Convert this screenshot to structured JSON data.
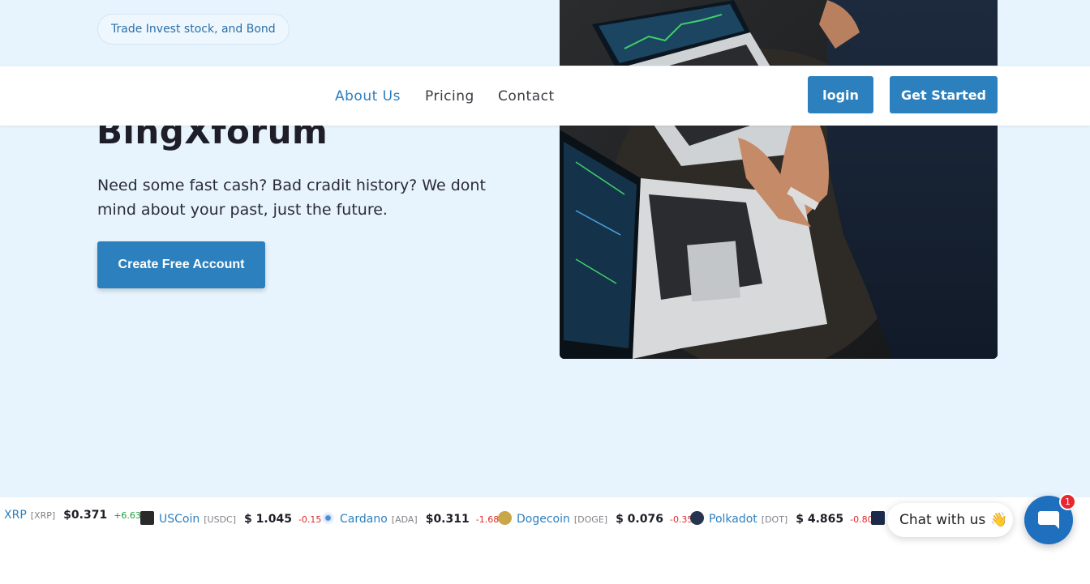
{
  "hero": {
    "pill_text": "Trade Invest stock, and Bond",
    "headline": "BingXforum",
    "lead": "Need some fast cash? Bad cradit history? We dont mind about your past, just the future.",
    "cta_label": "Create Free Account"
  },
  "nav": {
    "links": [
      {
        "label": "About Us",
        "active": true
      },
      {
        "label": "Pricing",
        "active": false
      },
      {
        "label": "Contact",
        "active": false
      }
    ],
    "login_label": "login",
    "start_label": "Get Started"
  },
  "ticker": [
    {
      "name": "XRP",
      "symbol": "[XRP]",
      "price": "$0.371",
      "change": "+6.63%",
      "direction": "up",
      "icon": "xrp-icon"
    },
    {
      "name": "USCoin",
      "symbol": "[USDC]",
      "price": "$ 1.045",
      "change": "-0.15%",
      "direction": "down",
      "icon": "usdc-icon"
    },
    {
      "name": "Cardano",
      "symbol": "[ADA]",
      "price": "$0.311",
      "change": "-1.68%",
      "direction": "down",
      "icon": "cardano-icon"
    },
    {
      "name": "Dogecoin",
      "symbol": "[DOGE]",
      "price": "$ 0.076",
      "change": "-0.35%",
      "direction": "down",
      "icon": "dogecoin-icon"
    },
    {
      "name": "Polkadot",
      "symbol": "[DOT]",
      "price": "$ 4.865",
      "change": "-0.80%",
      "direction": "down",
      "icon": "polkadot-icon"
    }
  ],
  "chat": {
    "label": "Chat with us",
    "emoji": "👋",
    "badge": "1"
  },
  "colors": {
    "accent": "#2c80bd",
    "hero_bg": "#e7f4fe",
    "up": "#1a9e3a",
    "down": "#e02a2a"
  }
}
